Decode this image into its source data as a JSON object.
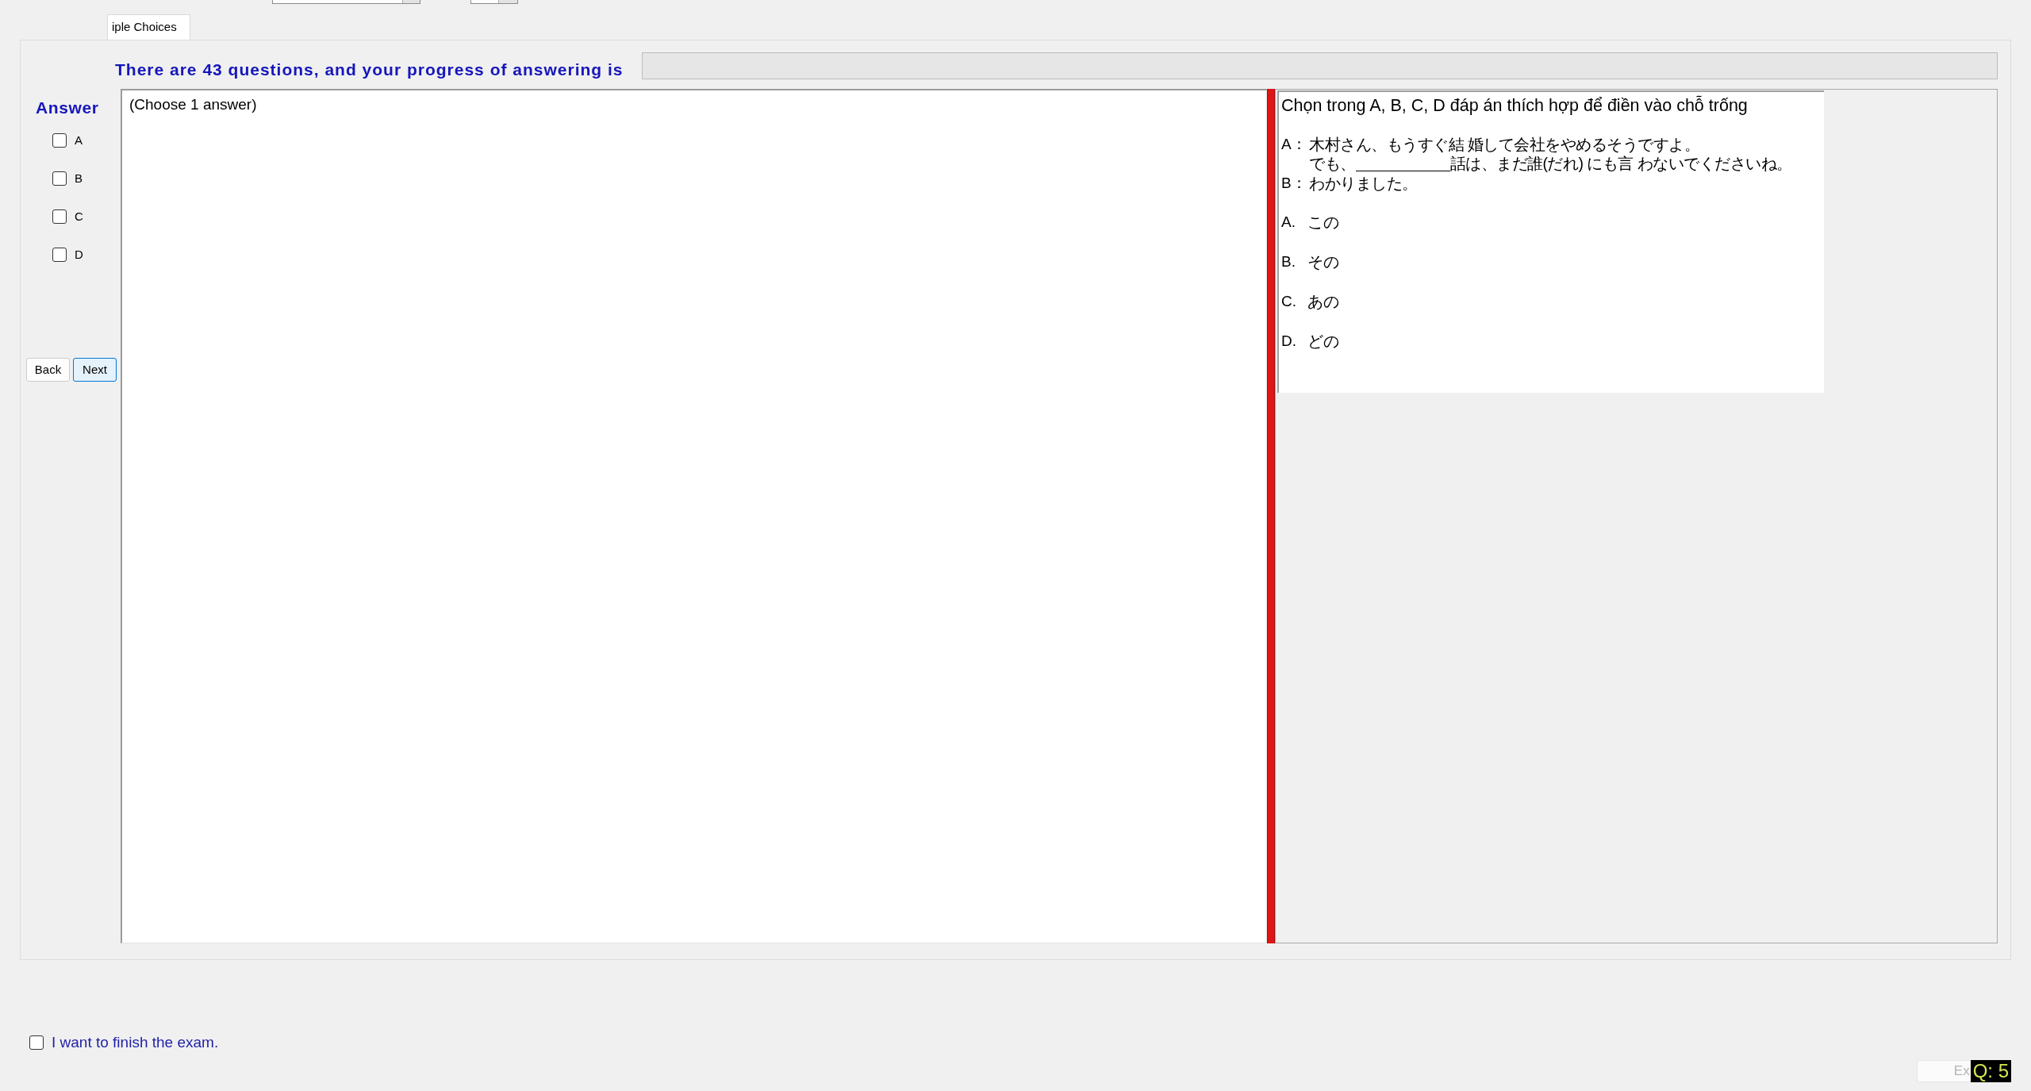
{
  "tabs": [
    {
      "label": "iple Choices",
      "selected": true
    }
  ],
  "progress": {
    "text": "There are 43 questions, and your progress of answering is",
    "level": 0
  },
  "answer_panel": {
    "title": "Answer",
    "options": [
      {
        "label": "A",
        "checked": false
      },
      {
        "label": "B",
        "checked": false
      },
      {
        "label": "C",
        "checked": false
      },
      {
        "label": "D",
        "checked": false
      }
    ],
    "buttons": [
      {
        "label": "Back",
        "focused": false
      },
      {
        "label": "Next",
        "focused": true
      }
    ]
  },
  "answer_area": {
    "hint": "(Choose 1 answer)"
  },
  "question": {
    "instruction": "Chọn trong A, B, C, D đáp án thích hợp để điền vào chỗ trống",
    "dialogue": [
      {
        "speaker": "A：",
        "parts": [
          {
            "kind": "text",
            "text": "木村さん、もうすぐ結 婚して会社をやめるそうですよ。"
          }
        ]
      },
      {
        "parts": [
          {
            "kind": "text",
            "text": "でも、"
          },
          {
            "kind": "blank"
          },
          {
            "kind": "text",
            "text": "話は、まだ誰(だれ) にも言 わないでくださいね。"
          }
        ]
      },
      {
        "speaker": "B：",
        "parts": [
          {
            "kind": "text",
            "text": "わかりました。"
          }
        ]
      }
    ],
    "choices": [
      {
        "letter": "A.",
        "text": "この"
      },
      {
        "letter": "B.",
        "text": "その"
      },
      {
        "letter": "C.",
        "text": "あの"
      },
      {
        "letter": "D.",
        "text": "どの"
      }
    ]
  },
  "finish": {
    "label": "I want to finish the exam.",
    "checked": false
  },
  "exit_button": {
    "label": "Ex",
    "disabled": true
  },
  "question_badge": "Q: 5"
}
